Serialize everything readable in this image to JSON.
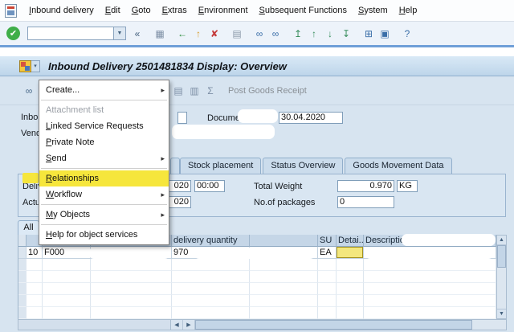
{
  "window": {
    "title": "Inbound Delivery 2501481834 Display: Overview"
  },
  "menubar": {
    "items": [
      {
        "label": "Inbound delivery"
      },
      {
        "label": "Edit"
      },
      {
        "label": "Goto"
      },
      {
        "label": "Extras"
      },
      {
        "label": "Environment"
      },
      {
        "label": "Subsequent Functions"
      },
      {
        "label": "System"
      },
      {
        "label": "Help"
      }
    ]
  },
  "toolbar": {
    "command_value": "",
    "dropdown_glyph": "▼",
    "enter_icon": {
      "name": "enter-icon",
      "glyph": "✔",
      "fg": "#ffffff",
      "bg": "#3fae49",
      "circle": true
    },
    "icons": [
      {
        "name": "collapse-icon",
        "glyph": "«",
        "fg": "#44617e"
      },
      {
        "name": "save-icon",
        "glyph": "▦",
        "fg": "#7d8fa5",
        "gap": true
      },
      {
        "name": "back-icon",
        "glyph": "←",
        "fg": "#2e8f3e",
        "gap": true
      },
      {
        "name": "exit-icon",
        "glyph": "↑",
        "fg": "#d79b27"
      },
      {
        "name": "cancel-icon",
        "glyph": "✘",
        "fg": "#c43b3b"
      },
      {
        "name": "print-icon",
        "glyph": "▤",
        "fg": "#8a98a8",
        "gap": true
      },
      {
        "name": "find-icon",
        "glyph": "∞",
        "fg": "#3a6ea8",
        "gap": true
      },
      {
        "name": "find-next-icon",
        "glyph": "∞",
        "fg": "#3a6ea8"
      },
      {
        "name": "first-page-icon",
        "glyph": "↥",
        "fg": "#3a8f5f",
        "gap": true
      },
      {
        "name": "prev-page-icon",
        "glyph": "↑",
        "fg": "#3a8f5f"
      },
      {
        "name": "next-page-icon",
        "glyph": "↓",
        "fg": "#3a8f5f"
      },
      {
        "name": "last-page-icon",
        "glyph": "↧",
        "fg": "#3a8f5f"
      },
      {
        "name": "new-session-icon",
        "glyph": "⊞",
        "fg": "#3a6ea8",
        "gap": true
      },
      {
        "name": "shortcut-icon",
        "glyph": "▣",
        "fg": "#3a6ea8"
      },
      {
        "name": "help-icon",
        "glyph": "?",
        "fg": "#3a6ea8",
        "gap": true
      }
    ]
  },
  "title_bar": {
    "gos_dropdown_glyph": "▾"
  },
  "app_toolbar": {
    "icons_left": [
      {
        "name": "display-glasses-icon",
        "glyph": "∞",
        "fg": "#4a6a8a"
      }
    ],
    "icons": [
      {
        "name": "items-detail-icon",
        "glyph": "▤",
        "fg": "#7d8fa5"
      },
      {
        "name": "unload-icon",
        "glyph": "▥",
        "fg": "#7d8fa5"
      },
      {
        "name": "sum-icon",
        "glyph": "Σ",
        "fg": "#7d8fa5"
      }
    ],
    "post_goods_receipt_label": "Post Goods Receipt"
  },
  "header_form": {
    "inbound_label": "Inbou",
    "document_date_label": "Document Date",
    "document_date_value": "30.04.2020",
    "vendor_label": "Vendo"
  },
  "tabs": {
    "items": [
      {
        "label": "Stock placement"
      },
      {
        "label": "Status Overview"
      },
      {
        "label": "Goods Movement Data"
      }
    ]
  },
  "delivery_fields": {
    "delivery_label": "Deliv",
    "delivery_date_visible": "020",
    "delivery_time": "00:00",
    "total_weight_label": "Total Weight",
    "total_weight_value": "0.970",
    "weight_unit": "KG",
    "actual_label": "Actu",
    "actual_date_visible": "020",
    "packages_label": "No.of packages",
    "packages_value": "0"
  },
  "items_section": {
    "view_tab_label": "All"
  },
  "items_table": {
    "headers": {
      "quantity": "delivery quantity",
      "su": "SU",
      "detail": "Detai...",
      "description": "Description"
    },
    "row": {
      "item_no": "10",
      "material": "F000",
      "quantity": "970",
      "unit": "EA"
    },
    "empty_row_count": 5
  },
  "context_menu": {
    "submenu_arrow": "▸",
    "items": [
      {
        "label": "Create...",
        "submenu": true
      },
      {
        "type": "separator"
      },
      {
        "label": "Attachment list",
        "disabled": true
      },
      {
        "label": "Linked Service Requests",
        "underline": true
      },
      {
        "label": "Private Note",
        "underline": true
      },
      {
        "label": "Send",
        "submenu": true,
        "underline": true
      },
      {
        "type": "separator"
      },
      {
        "label": "Relationships",
        "highlighted": true,
        "underline": true
      },
      {
        "label": "Workflow",
        "submenu": true,
        "underline": true
      },
      {
        "type": "separator"
      },
      {
        "label": "My Objects",
        "submenu": true,
        "underline": true
      },
      {
        "type": "separator"
      },
      {
        "label": "Help for object services",
        "underline": true
      }
    ]
  },
  "scrollbar": {
    "left": "◀",
    "right": "▶",
    "up": "▲",
    "down": "▼"
  },
  "colors": {
    "menu_highlight": "#f6e63c",
    "detail_cell": "#f3e77e",
    "toolbar_line": "#6f9fd8",
    "titlebar_top": "#d9e9f6",
    "titlebar_bottom": "#bdd5ea"
  }
}
